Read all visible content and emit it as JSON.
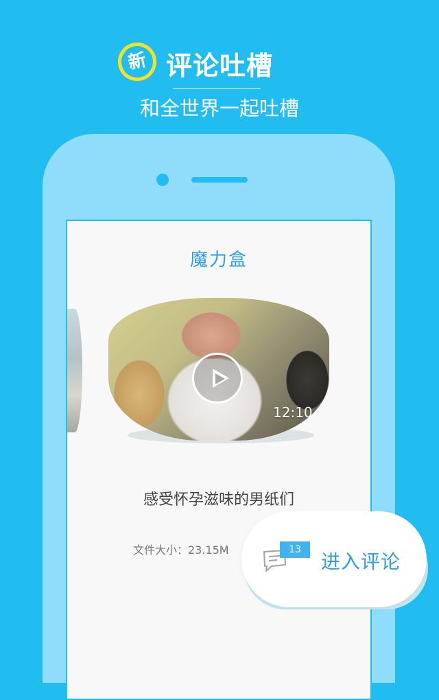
{
  "promo": {
    "badge": "新",
    "title": "评论吐槽",
    "subtitle": "和全世界一起吐槽"
  },
  "screen": {
    "title": "魔力盒",
    "video": {
      "duration": "12:10",
      "caption": "感受怀孕滋味的男纸们"
    },
    "file_size": "文件大小：23.15M"
  },
  "comment_button": {
    "count": "13",
    "label": "进入评论"
  },
  "colors": {
    "background": "#22bdf0",
    "phone_body": "#8fdcfb",
    "accent_text": "#2e9ee6",
    "badge_ring": "#f4e227"
  }
}
